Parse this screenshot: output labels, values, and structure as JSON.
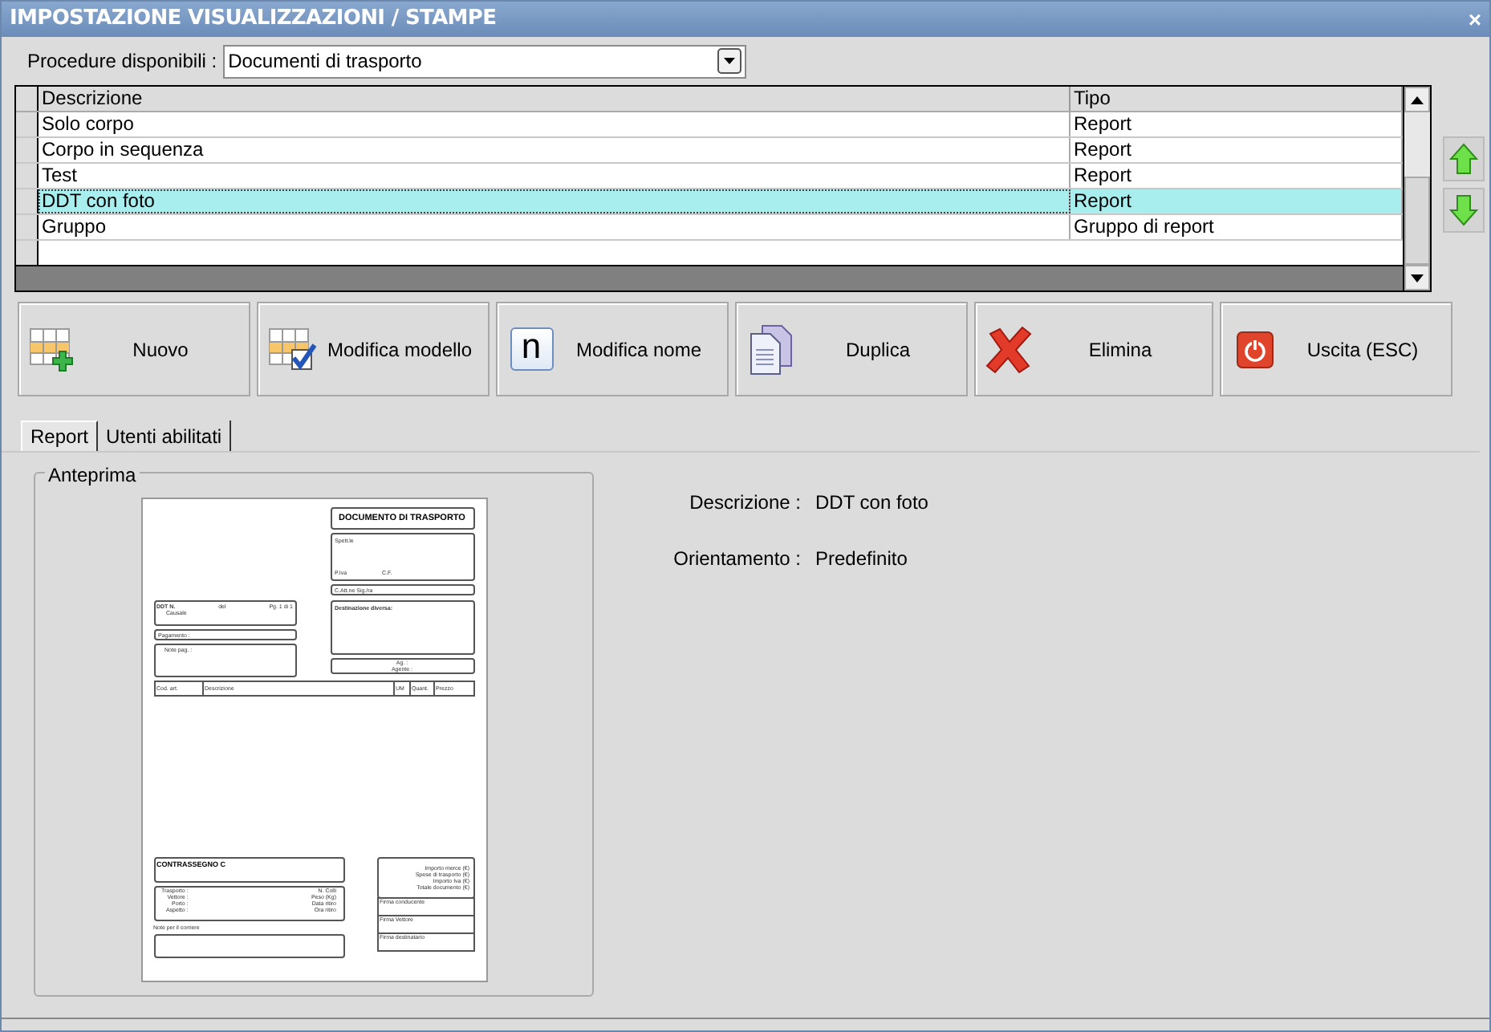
{
  "window": {
    "title": "IMPOSTAZIONE VISUALIZZAZIONI / STAMPE",
    "close": "×"
  },
  "procedure": {
    "label": "Procedure disponibili :",
    "value": "Documenti di trasporto"
  },
  "table": {
    "columns": [
      "Descrizione",
      "Tipo"
    ],
    "rows": [
      {
        "cells": [
          "Solo corpo",
          "Report"
        ],
        "selected": false
      },
      {
        "cells": [
          "Corpo in sequenza",
          "Report"
        ],
        "selected": false
      },
      {
        "cells": [
          "Test",
          "Report"
        ],
        "selected": false
      },
      {
        "cells": [
          "DDT con foto",
          "Report"
        ],
        "selected": true
      },
      {
        "cells": [
          "Gruppo",
          "Gruppo di report"
        ],
        "selected": false
      }
    ]
  },
  "buttons": [
    {
      "kind": "add",
      "label": "Nuovo"
    },
    {
      "kind": "edit",
      "label": "Modifica modello"
    },
    {
      "kind": "rename",
      "label": "Modifica nome",
      "glyph": "n"
    },
    {
      "kind": "duplicate",
      "label": "Duplica"
    },
    {
      "kind": "delete",
      "label": "Elimina"
    },
    {
      "kind": "exit",
      "label": "Uscita (ESC)"
    }
  ],
  "tabs": [
    {
      "label": "Report",
      "selected": true
    },
    {
      "label": "Utenti abilitati",
      "selected": false
    }
  ],
  "preview": {
    "title": "Anteprima",
    "document": {
      "title": "DOCUMENTO DI TRASPORTO",
      "recipient": "Spett.le",
      "vat": "P.Iva",
      "tax_code": "C.F.",
      "attention": "C.Att.ne Sig./ra",
      "ddt_number": "DDT N.",
      "ddt_date": "del",
      "ddt_page": "Pg. 1 di 1",
      "reason": "Causale",
      "payment": "Pagamento :",
      "payment_notes": "Note pag. :",
      "destination": "Destinazione diversa:",
      "agent_lines": [
        "Ag. :",
        "Agente :"
      ],
      "columns": [
        "Cod. art.",
        "Descrizione",
        "UM",
        "Quant.",
        "Prezzo"
      ],
      "cod": "CONTRASSEGNO C",
      "shipping_labels": [
        "Trasporto :",
        "Vettore :",
        "Porto :",
        "Aspetto :"
      ],
      "shipping_values": [
        "N. Colli",
        "Peso (Kg)",
        "Data ritiro",
        "Ora ritiro"
      ],
      "courier_notes": "Note per il corriere",
      "totals": [
        "Importo merce (€)",
        "Spese di trasporto (€)",
        "Importo Iva (€)",
        "Totale documento (€)"
      ],
      "signatures": [
        "Firma conducente",
        "Firma Vettore",
        "Firma destinatario"
      ]
    }
  },
  "details": [
    {
      "label": "Descrizione :",
      "value": "DDT con foto"
    },
    {
      "label": "Orientamento :",
      "value": "Predefinito"
    }
  ]
}
